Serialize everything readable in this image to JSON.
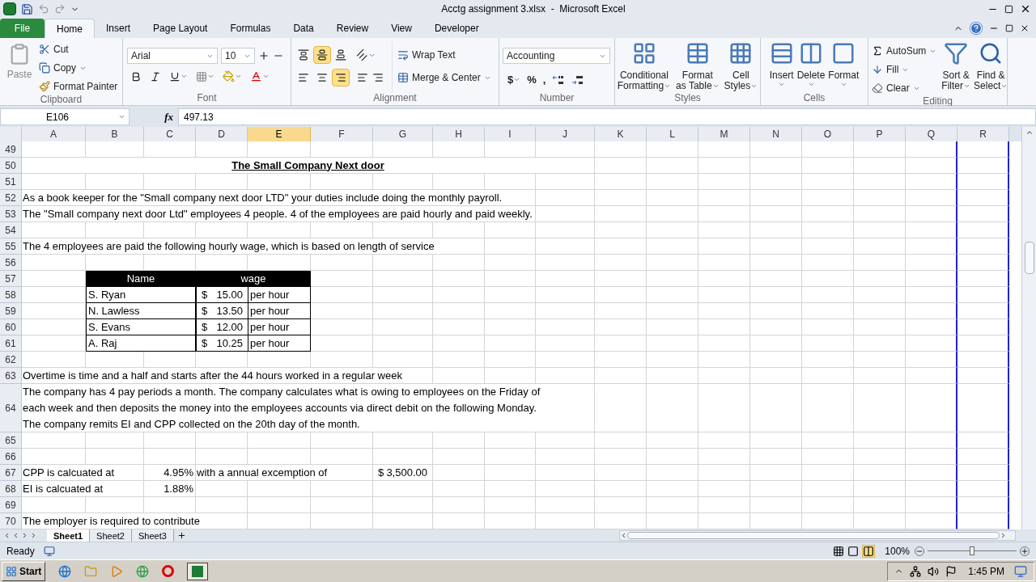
{
  "window": {
    "title": "Acctg assignment 3.xlsx  -  Microsoft Excel"
  },
  "ribbon_tabs": [
    {
      "label": "File",
      "kind": "file",
      "selected": false
    },
    {
      "label": "Home",
      "kind": "tab",
      "selected": true
    },
    {
      "label": "Insert",
      "kind": "tab",
      "selected": false
    },
    {
      "label": "Page Layout",
      "kind": "tab",
      "selected": false
    },
    {
      "label": "Formulas",
      "kind": "tab",
      "selected": false
    },
    {
      "label": "Data",
      "kind": "tab",
      "selected": false
    },
    {
      "label": "Review",
      "kind": "tab",
      "selected": false
    },
    {
      "label": "View",
      "kind": "tab",
      "selected": false
    },
    {
      "label": "Developer",
      "kind": "tab",
      "selected": false
    }
  ],
  "clipboard": {
    "paste": "Paste",
    "cut": "Cut",
    "copy": "Copy",
    "format_painter": "Format Painter",
    "label": "Clipboard"
  },
  "font": {
    "name": "Arial",
    "size": "10",
    "label": "Font"
  },
  "alignment": {
    "vertical": [
      {
        "selected": false
      },
      {
        "selected": true
      },
      {
        "selected": false
      }
    ],
    "horizontal": [
      {
        "selected": false
      },
      {
        "selected": false
      },
      {
        "selected": true
      }
    ],
    "wrap_text": "Wrap Text",
    "merge": "Merge & Center",
    "label": "Alignment"
  },
  "number": {
    "format": "Accounting",
    "symbols": [
      "$",
      "%",
      ","
    ],
    "label": "Number"
  },
  "styles": {
    "buttons": [
      {
        "lines": [
          "Conditional",
          "Formatting"
        ]
      },
      {
        "lines": [
          "Format",
          "as Table"
        ]
      },
      {
        "lines": [
          "Cell",
          "Styles"
        ]
      }
    ],
    "label": "Styles"
  },
  "cells": {
    "buttons": [
      "Insert",
      "Delete",
      "Format"
    ],
    "label": "Cells"
  },
  "editing": {
    "autosum": "AutoSum",
    "fill": "Fill",
    "clear": "Clear",
    "sort": [
      "Sort &",
      "Filter"
    ],
    "find": [
      "Find &",
      "Select"
    ],
    "label": "Editing"
  },
  "formula_bar": {
    "name_box": "E106",
    "function_symbol": "fx",
    "value": "497.13"
  },
  "columns": [
    {
      "label": "A",
      "selected": false
    },
    {
      "label": "B",
      "selected": false
    },
    {
      "label": "C",
      "selected": false
    },
    {
      "label": "D",
      "selected": false
    },
    {
      "label": "E",
      "selected": true
    },
    {
      "label": "F",
      "selected": false
    },
    {
      "label": "G",
      "selected": false
    },
    {
      "label": "H",
      "selected": false
    },
    {
      "label": "I",
      "selected": false
    },
    {
      "label": "J",
      "selected": false
    },
    {
      "label": "K",
      "selected": false
    },
    {
      "label": "L",
      "selected": false
    },
    {
      "label": "M",
      "selected": false
    },
    {
      "label": "N",
      "selected": false
    },
    {
      "label": "O",
      "selected": false
    },
    {
      "label": "P",
      "selected": false
    },
    {
      "label": "Q",
      "selected": false
    },
    {
      "label": "R",
      "selected": false
    }
  ],
  "rows": [
    {
      "number": "49"
    },
    {
      "number": "50",
      "cells": [
        {
          "kind": "title",
          "text": "The Small Company Next door"
        },
        {
          "kind": "merged"
        },
        {
          "kind": "merged"
        },
        {
          "kind": "merged"
        },
        {
          "kind": "merged"
        },
        {
          "kind": "merged"
        },
        {
          "kind": "merged"
        },
        {
          "kind": "merged"
        },
        {
          "kind": "merged"
        },
        {
          "kind": "merged"
        }
      ]
    },
    {
      "number": "51"
    },
    {
      "number": "52",
      "cells": [
        {
          "kind": "text",
          "text": "As a book keeper for the \"Small company next door LTD\" your duties include doing the monthly payroll."
        }
      ]
    },
    {
      "number": "53",
      "cells": [
        {
          "kind": "text",
          "text": "The \"Small company next door Ltd\" employees 4 people. 4 of the employees are paid hourly and paid weekly."
        }
      ]
    },
    {
      "number": "54"
    },
    {
      "number": "55",
      "cells": [
        {
          "kind": "text",
          "text": "The 4 employees are paid the following hourly wage, which is based on length of service"
        }
      ]
    },
    {
      "number": "56"
    },
    {
      "number": "57",
      "cells": [
        {
          "kind": "empty"
        },
        {
          "kind": "header",
          "text": "Name"
        },
        {
          "kind": "merged"
        },
        {
          "kind": "header",
          "text": "wage"
        },
        {
          "kind": "merged"
        }
      ]
    },
    {
      "number": "58",
      "cells": [
        {
          "kind": "empty"
        },
        {
          "kind": "table",
          "text": "S. Ryan"
        },
        {
          "kind": "merged"
        },
        {
          "kind": "table_money",
          "currency": "$",
          "text": "15.00"
        },
        {
          "kind": "table",
          "text": "per hour"
        }
      ]
    },
    {
      "number": "59",
      "cells": [
        {
          "kind": "empty"
        },
        {
          "kind": "table",
          "text": "N. Lawless"
        },
        {
          "kind": "merged"
        },
        {
          "kind": "table_money",
          "currency": "$",
          "text": "13.50"
        },
        {
          "kind": "table",
          "text": "per hour"
        }
      ]
    },
    {
      "number": "60",
      "cells": [
        {
          "kind": "empty"
        },
        {
          "kind": "table",
          "text": "S. Evans"
        },
        {
          "kind": "merged"
        },
        {
          "kind": "table_money",
          "currency": "$",
          "text": "12.00"
        },
        {
          "kind": "table",
          "text": "per hour"
        }
      ]
    },
    {
      "number": "61",
      "cells": [
        {
          "kind": "empty"
        },
        {
          "kind": "table",
          "text": "A. Raj"
        },
        {
          "kind": "merged"
        },
        {
          "kind": "table_money",
          "currency": "$",
          "text": "10.25"
        },
        {
          "kind": "table",
          "text": "per hour"
        }
      ]
    },
    {
      "number": "62"
    },
    {
      "number": "63",
      "cells": [
        {
          "kind": "text",
          "text": "Overtime is time and a half and starts after the 44 hours worked in a regular week"
        }
      ]
    },
    {
      "number": "64",
      "cells": [
        {
          "kind": "wrapped",
          "lines": [
            "The company has 4 pay periods a month. The company calculates what is owing to employees on the Friday of",
            "each week and then deposits the money into the employees accounts via direct debit on the following Monday.",
            "The company remits EI and CPP collected on the 20th day of the month."
          ]
        },
        {
          "kind": "merged"
        },
        {
          "kind": "merged"
        },
        {
          "kind": "merged"
        },
        {
          "kind": "merged"
        },
        {
          "kind": "merged"
        },
        {
          "kind": "merged"
        },
        {
          "kind": "merged"
        },
        {
          "kind": "merged"
        },
        {
          "kind": "merged"
        }
      ]
    },
    {
      "number": "65"
    },
    {
      "number": "66"
    },
    {
      "number": "67",
      "cells": [
        {
          "kind": "text",
          "text": "CPP is calcuated at"
        },
        {
          "kind": "empty"
        },
        {
          "kind": "number",
          "text": "4.95%"
        },
        {
          "kind": "text",
          "text": "with a annual excemption of"
        },
        {
          "kind": "empty"
        },
        {
          "kind": "empty"
        },
        {
          "kind": "accounting",
          "currency": "$",
          "text": "3,500.00"
        }
      ]
    },
    {
      "number": "68",
      "cells": [
        {
          "kind": "text",
          "text": "EI is calcuated at"
        },
        {
          "kind": "empty"
        },
        {
          "kind": "number",
          "text": "1.88%"
        }
      ]
    },
    {
      "number": "69"
    },
    {
      "number": "70",
      "cells": [
        {
          "kind": "text",
          "text": "The employer is required to contribute"
        }
      ]
    }
  ],
  "sheet_tabs": [
    {
      "label": "Sheet1",
      "selected": true
    },
    {
      "label": "Sheet2",
      "selected": false
    },
    {
      "label": "Sheet3",
      "selected": false
    }
  ],
  "status_bar": {
    "text": "Ready",
    "zoom": "100%",
    "zoom_slider": {
      "level": 0.5
    }
  },
  "taskbar": {
    "start": "Start",
    "clock": "1:45 PM"
  }
}
